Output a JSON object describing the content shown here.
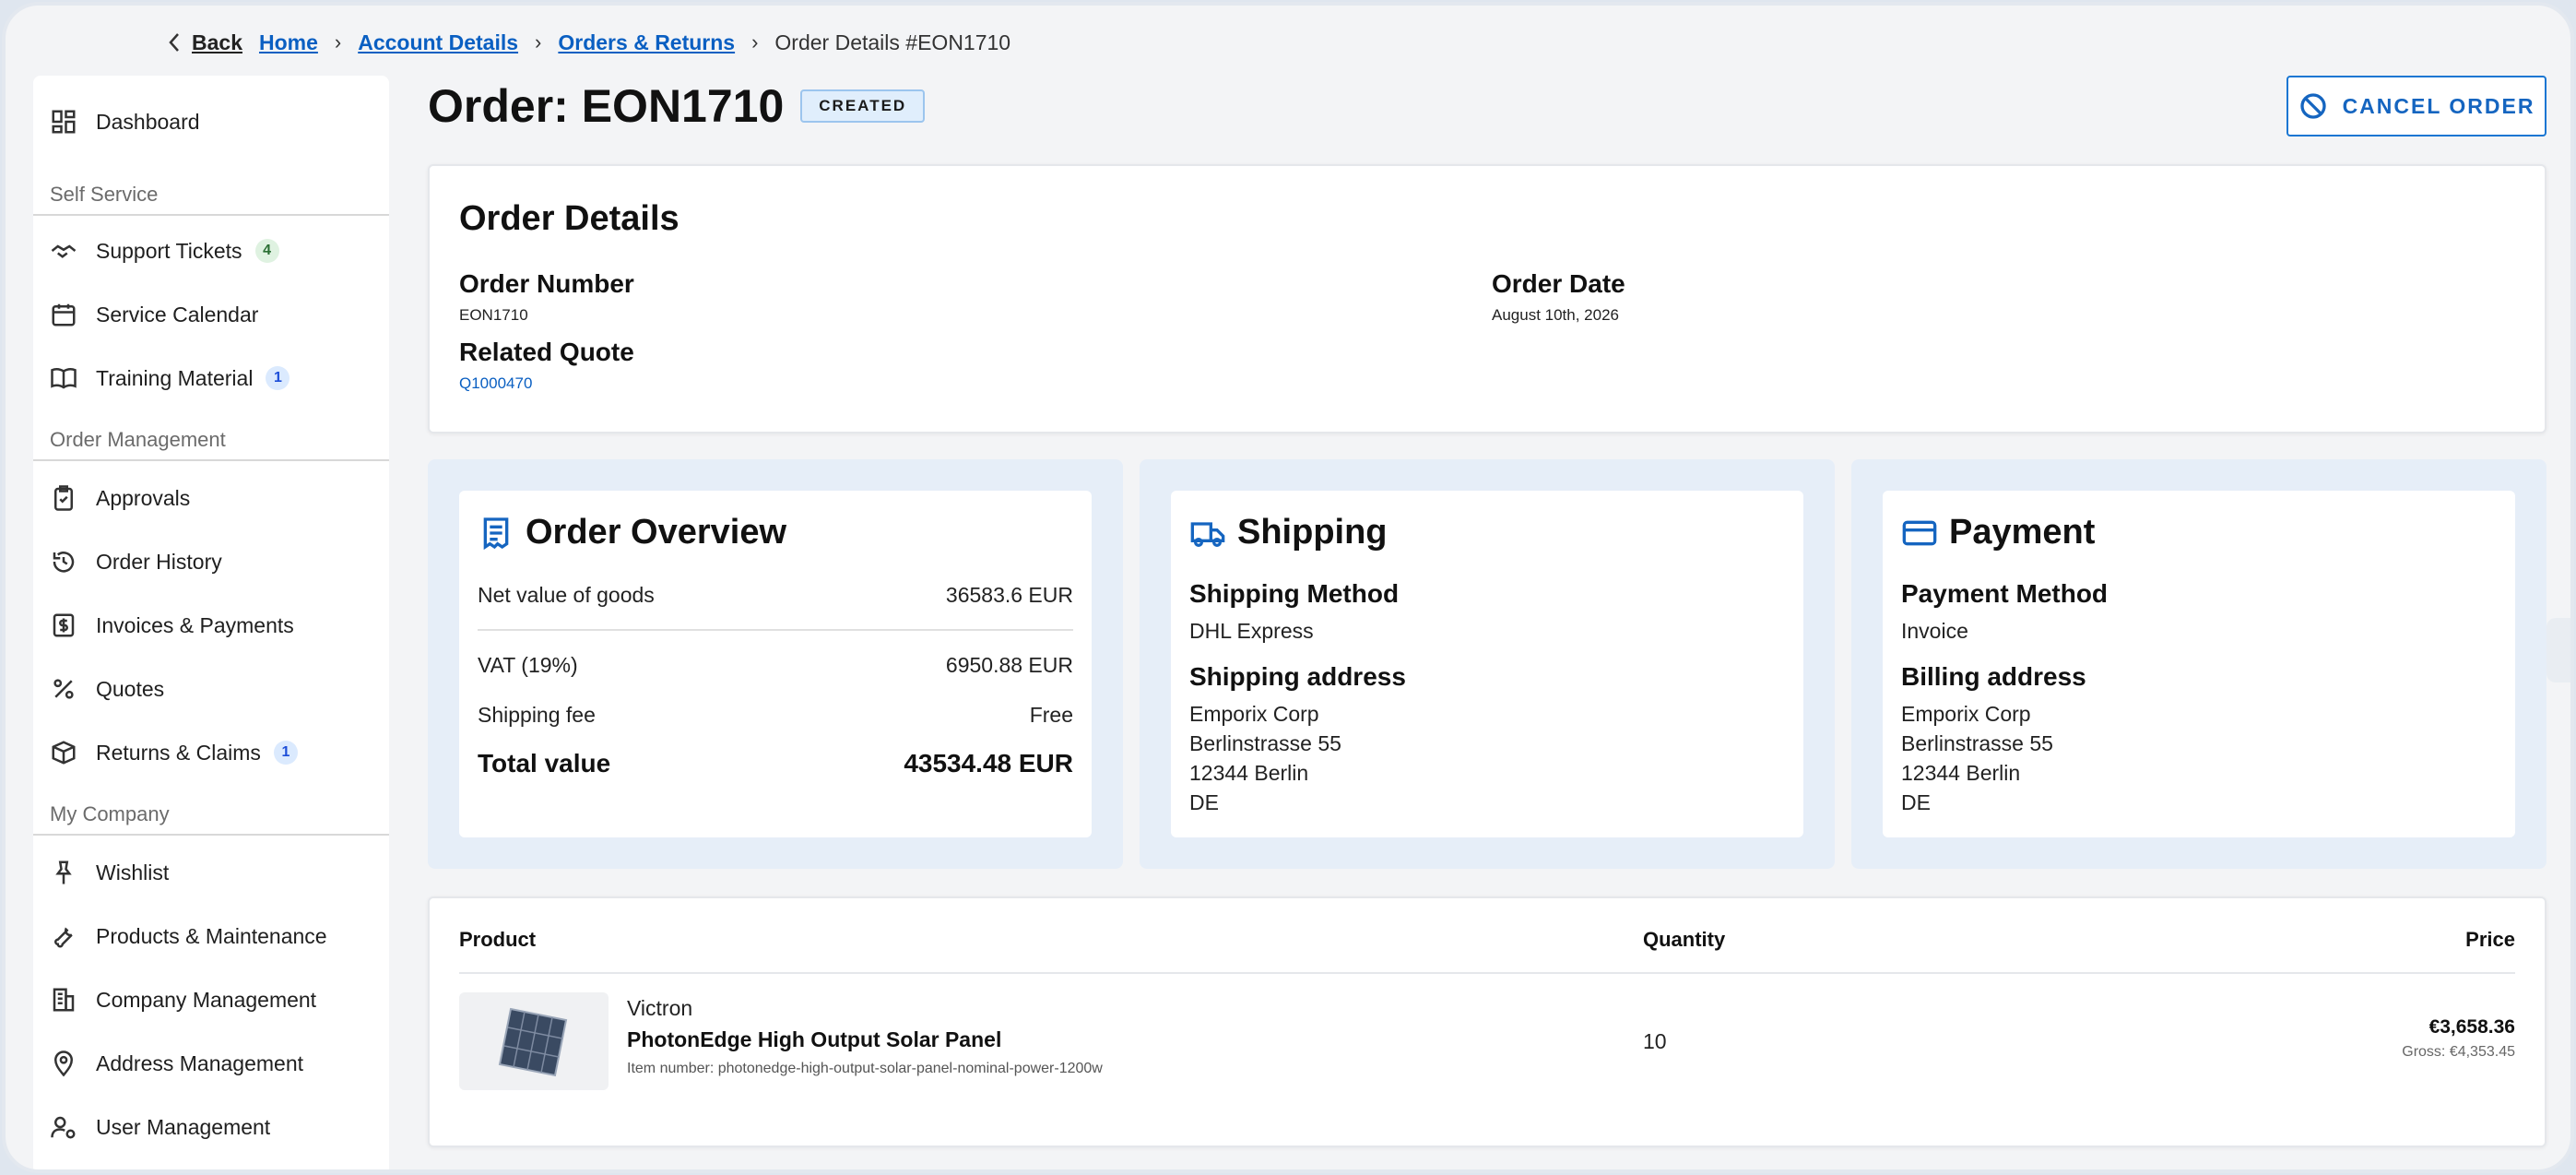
{
  "breadcrumb": {
    "back_label": "Back",
    "items": [
      "Home",
      "Account Details",
      "Orders & Returns"
    ],
    "current": "Order Details #EON1710"
  },
  "sidebar": {
    "dashboard": "Dashboard",
    "sections": [
      {
        "title": "Self Service",
        "items": [
          {
            "label": "Support Tickets",
            "badge": "4",
            "icon": "handshake-icon"
          },
          {
            "label": "Service Calendar",
            "badge": "",
            "icon": "calendar-icon"
          },
          {
            "label": "Training Material",
            "badge": "1",
            "icon": "book-icon"
          }
        ]
      },
      {
        "title": "Order Management",
        "items": [
          {
            "label": "Approvals",
            "badge": "",
            "icon": "clipboard-check-icon"
          },
          {
            "label": "Order History",
            "badge": "",
            "icon": "history-icon"
          },
          {
            "label": "Invoices & Payments",
            "badge": "",
            "icon": "dollar-doc-icon"
          },
          {
            "label": "Quotes",
            "badge": "",
            "icon": "percent-icon"
          },
          {
            "label": "Returns & Claims",
            "badge": "1",
            "icon": "package-icon"
          }
        ]
      },
      {
        "title": "My Company",
        "items": [
          {
            "label": "Wishlist",
            "badge": "",
            "icon": "pin-icon"
          },
          {
            "label": "Products & Maintenance",
            "badge": "",
            "icon": "wrench-icon"
          },
          {
            "label": "Company Management",
            "badge": "",
            "icon": "building-icon"
          },
          {
            "label": "Address Management",
            "badge": "",
            "icon": "location-icon"
          },
          {
            "label": "User Management",
            "badge": "",
            "icon": "user-gear-icon"
          }
        ]
      }
    ]
  },
  "header": {
    "title": "Order: EON1710",
    "status": "CREATED",
    "cancel_label": "CANCEL ORDER"
  },
  "order_details": {
    "heading": "Order Details",
    "order_number_label": "Order Number",
    "order_number": "EON1710",
    "order_date_label": "Order Date",
    "order_date": "August 10th, 2026",
    "related_quote_label": "Related Quote",
    "related_quote": "Q1000470"
  },
  "overview": {
    "heading": "Order Overview",
    "net_label": "Net value of goods",
    "net_value": "36583.6 EUR",
    "vat_label": "VAT (19%)",
    "vat_value": "6950.88 EUR",
    "shipping_fee_label": "Shipping fee",
    "shipping_fee_value": "Free",
    "total_label": "Total value",
    "total_value": "43534.48 EUR"
  },
  "shipping": {
    "heading": "Shipping",
    "method_label": "Shipping Method",
    "method": "DHL Express",
    "address_label": "Shipping address",
    "address_lines": [
      "Emporix Corp",
      "Berlinstrasse 55",
      "12344 Berlin",
      "DE"
    ]
  },
  "payment": {
    "heading": "Payment",
    "method_label": "Payment Method",
    "method": "Invoice",
    "address_label": "Billing address",
    "address_lines": [
      "Emporix Corp",
      "Berlinstrasse 55",
      "12344 Berlin",
      "DE"
    ]
  },
  "products": {
    "col_product": "Product",
    "col_quantity": "Quantity",
    "col_price": "Price",
    "rows": [
      {
        "brand": "Victron",
        "name": "PhotonEdge High Output Solar Panel",
        "item_number": "Item number: photonedge-high-output-solar-panel-nominal-power-1200w",
        "quantity": "10",
        "price": "€3,658.36",
        "gross": "Gross: €4,353.45"
      }
    ]
  },
  "colors": {
    "accent": "#1565c0",
    "panel_bg": "#e6eef8"
  }
}
